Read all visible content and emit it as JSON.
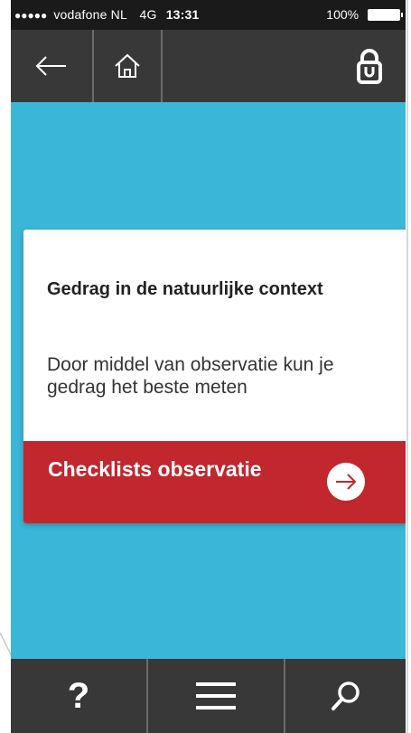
{
  "status_bar": {
    "signal_dots": "●●●●●",
    "carrier": "vodafone NL",
    "network": "4G",
    "time": "13:31",
    "battery": "100%"
  },
  "top_nav": {
    "back_icon": "arrow-left-icon",
    "home_icon": "home-icon",
    "lock_icon": "padlock-icon"
  },
  "card": {
    "title": "Gedrag in de natuurlijke context",
    "description": "Door middel van observatie kun je gedrag het beste meten",
    "action_label": "Checklists observatie",
    "action_icon": "arrow-right-circle-icon"
  },
  "bottom_bar": {
    "help_label": "?",
    "menu_icon": "hamburger-menu-icon",
    "search_icon": "search-icon"
  },
  "colors": {
    "background": "#3ab6d8",
    "bar": "#383838",
    "accent": "#c1272d",
    "card": "#ffffff"
  }
}
